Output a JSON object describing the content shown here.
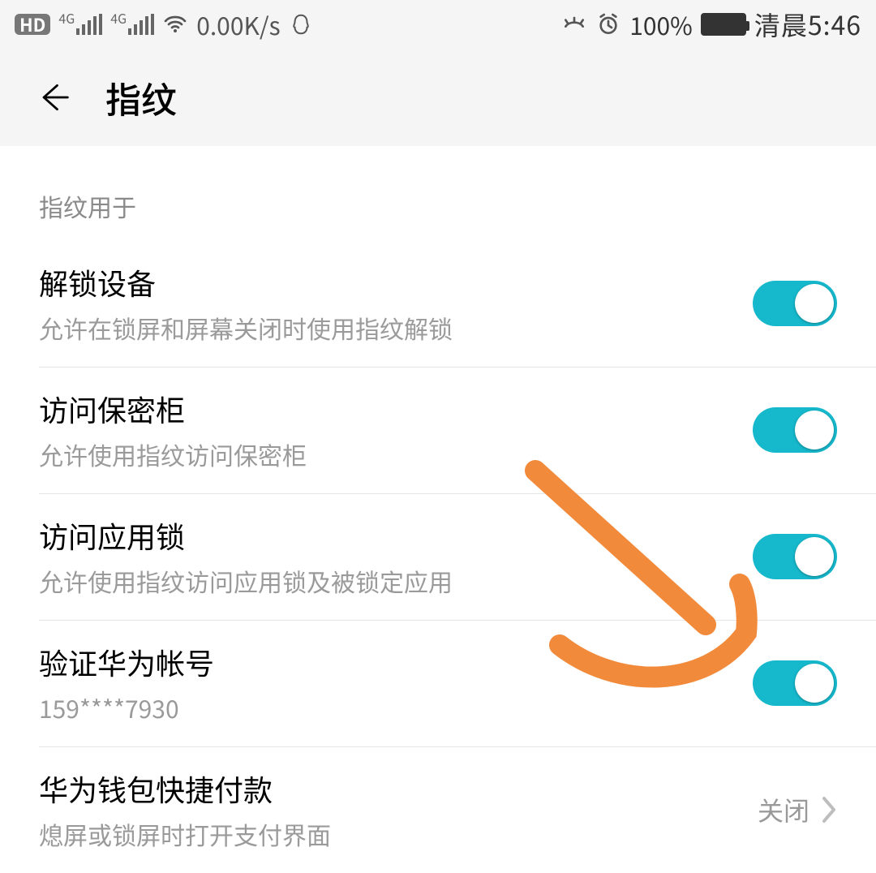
{
  "status_bar": {
    "hd_label": "HD",
    "signal1_label": "4G",
    "signal2_label": "4G",
    "speed": "0.00K/s",
    "battery_pct": "100%",
    "clock": "清晨5:46"
  },
  "header": {
    "title": "指纹"
  },
  "section_label": "指纹用于",
  "rows": [
    {
      "title": "解锁设备",
      "sub": "允许在锁屏和屏幕关闭时使用指纹解锁"
    },
    {
      "title": "访问保密柜",
      "sub": "允许使用指纹访问保密柜"
    },
    {
      "title": "访问应用锁",
      "sub": "允许使用指纹访问应用锁及被锁定应用"
    },
    {
      "title": "验证华为帐号",
      "sub": "159****7930"
    },
    {
      "title": "华为钱包快捷付款",
      "sub": "熄屏或锁屏时打开支付界面",
      "status": "关闭"
    }
  ],
  "colors": {
    "accent": "#16b8cc",
    "annotation": "#f28a3b"
  }
}
